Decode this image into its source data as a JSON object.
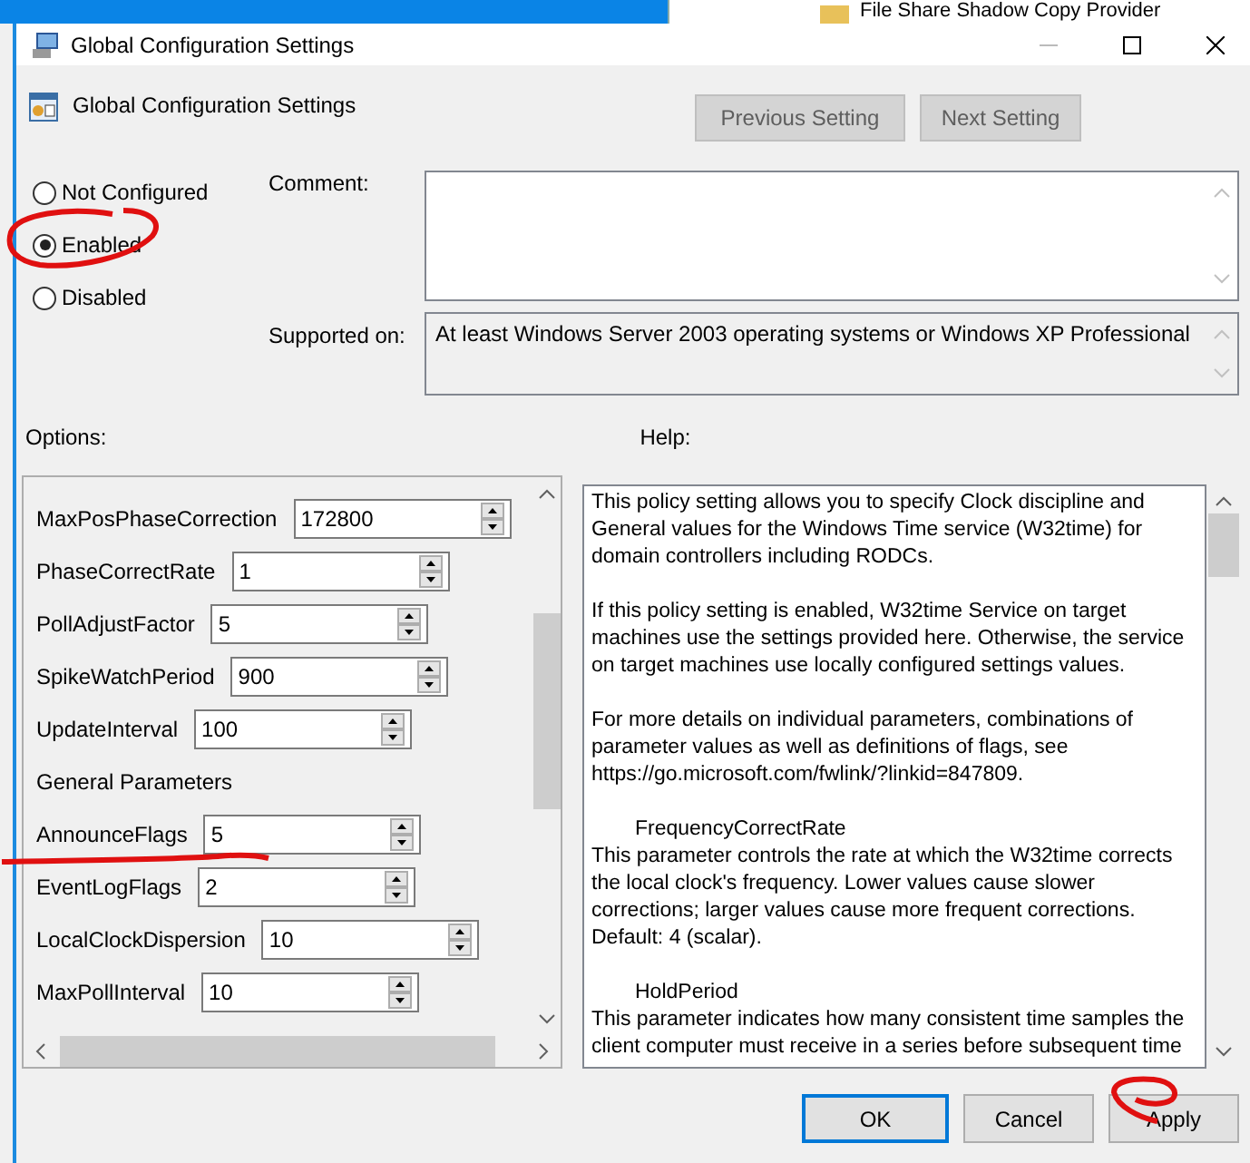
{
  "background": {
    "text": "File Share Shadow Copy Provider"
  },
  "window": {
    "title": "Global Configuration Settings"
  },
  "policy": {
    "title": "Global Configuration Settings",
    "buttons": [
      {
        "label": "Previous Setting",
        "disabled": true
      },
      {
        "label": "Next Setting",
        "disabled": true
      }
    ]
  },
  "state_options": [
    {
      "label": "Not Configured",
      "selected": false
    },
    {
      "label": "Enabled",
      "selected": true
    },
    {
      "label": "Disabled",
      "selected": false
    }
  ],
  "comment": {
    "label": "Comment:"
  },
  "supported_on": {
    "label": "Supported on:",
    "value": "At least Windows Server 2003 operating systems or Windows XP Professional"
  },
  "options": {
    "label": "Options:",
    "rows": [
      {
        "kind": "spin",
        "label": "MaxPosPhaseCorrection",
        "value": "172800"
      },
      {
        "kind": "spin",
        "label": "PhaseCorrectRate",
        "value": "1"
      },
      {
        "kind": "spin",
        "label": "PollAdjustFactor",
        "value": "5"
      },
      {
        "kind": "spin",
        "label": "SpikeWatchPeriod",
        "value": "900"
      },
      {
        "kind": "spin",
        "label": "UpdateInterval",
        "value": "100"
      },
      {
        "kind": "heading",
        "label": "General Parameters"
      },
      {
        "kind": "spin",
        "label": "AnnounceFlags",
        "value": "5"
      },
      {
        "kind": "spin",
        "label": "EventLogFlags",
        "value": "2"
      },
      {
        "kind": "spin",
        "label": "LocalClockDispersion",
        "value": "10"
      },
      {
        "kind": "spin",
        "label": "MaxPollInterval",
        "value": "10"
      }
    ]
  },
  "help": {
    "label": "Help:",
    "paragraphs": [
      {
        "kind": "text",
        "text": "This policy setting allows you to specify Clock discipline and General values for the Windows Time service (W32time) for domain controllers including RODCs."
      },
      {
        "kind": "text",
        "text": "If this policy setting is enabled, W32time Service on target machines use the settings provided here. Otherwise, the service on target machines use locally configured settings values."
      },
      {
        "kind": "text",
        "text": "For more details on individual parameters, combinations of parameter values as well as definitions of flags, see https://go.microsoft.com/fwlink/?linkid=847809."
      },
      {
        "kind": "heading",
        "text": "FrequencyCorrectRate"
      },
      {
        "kind": "body",
        "text": "This parameter controls the rate at which the W32time corrects the local clock's frequency. Lower values cause slower corrections; larger values cause more frequent corrections. Default: 4 (scalar)."
      },
      {
        "kind": "heading",
        "text": "HoldPeriod"
      },
      {
        "kind": "body",
        "text": "This parameter indicates how many consistent time samples the client computer must receive in a series before subsequent time"
      }
    ]
  },
  "buttons": [
    {
      "label": "OK",
      "default": true
    },
    {
      "label": "Cancel",
      "default": false
    },
    {
      "label": "Apply",
      "default": false
    }
  ]
}
